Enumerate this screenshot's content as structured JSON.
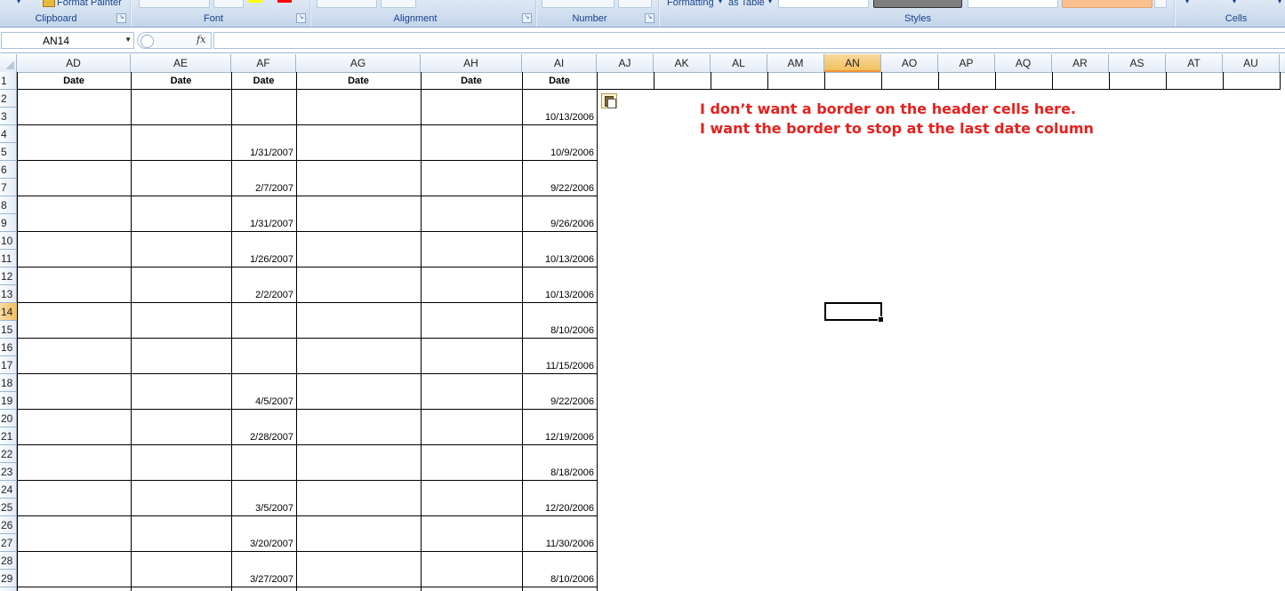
{
  "ribbon": {
    "clipboard": {
      "label": "Clipboard",
      "format_painter_label": "Format Painter"
    },
    "font": {
      "label": "Font"
    },
    "alignment": {
      "label": "Alignment"
    },
    "number": {
      "label": "Number"
    },
    "styles": {
      "label": "Styles",
      "formatting_label": "Formatting",
      "as_table_label": "as Table"
    },
    "cells": {
      "label": "Cells"
    }
  },
  "formula_bar": {
    "name_box": "AN14",
    "fx_label": "fx",
    "formula": ""
  },
  "columns": [
    "AD",
    "AE",
    "AF",
    "AG",
    "AH",
    "AI",
    "AJ",
    "AK",
    "AL",
    "AM",
    "AN",
    "AO",
    "AP",
    "AQ",
    "AR",
    "AS",
    "AT",
    "AU"
  ],
  "selected_column": "AN",
  "rows": [
    "1",
    "2",
    "3",
    "4",
    "5",
    "6",
    "7",
    "8",
    "9",
    "10",
    "11",
    "12",
    "13",
    "14",
    "15",
    "16",
    "17",
    "18",
    "19",
    "20",
    "21",
    "22",
    "23",
    "24",
    "25",
    "26",
    "27",
    "28",
    "29"
  ],
  "selected_row": "14",
  "header_row": {
    "AD": "Date",
    "AE": "Date",
    "AF": "Date",
    "AG": "Date",
    "AH": "Date",
    "AI": "Date"
  },
  "date_rows": [
    {
      "row": "3",
      "AF": "",
      "AI": "10/13/2006"
    },
    {
      "row": "5",
      "AF": "1/31/2007",
      "AI": "10/9/2006"
    },
    {
      "row": "7",
      "AF": "2/7/2007",
      "AI": "9/22/2006"
    },
    {
      "row": "9",
      "AF": "1/31/2007",
      "AI": "9/26/2006"
    },
    {
      "row": "11",
      "AF": "1/26/2007",
      "AI": "10/13/2006"
    },
    {
      "row": "13",
      "AF": "2/2/2007",
      "AI": "10/13/2006"
    },
    {
      "row": "15",
      "AF": "",
      "AI": "8/10/2006"
    },
    {
      "row": "17",
      "AF": "",
      "AI": "11/15/2006"
    },
    {
      "row": "19",
      "AF": "4/5/2007",
      "AI": "9/22/2006"
    },
    {
      "row": "21",
      "AF": "2/28/2007",
      "AI": "12/19/2006"
    },
    {
      "row": "23",
      "AF": "",
      "AI": "8/18/2006"
    },
    {
      "row": "25",
      "AF": "3/5/2007",
      "AI": "12/20/2006"
    },
    {
      "row": "27",
      "AF": "3/20/2007",
      "AI": "11/30/2006"
    },
    {
      "row": "29",
      "AF": "3/27/2007",
      "AI": "8/10/2006"
    }
  ],
  "annotation": {
    "line1": "I don’t want a border on the header  cells here.",
    "line2": "I want the border to stop at the last date column"
  },
  "icons": [
    "paste-options-icon",
    "fx-icon",
    "name-box-dropdown-icon",
    "select-all-icon"
  ],
  "colors": {
    "annotation": "#e8201d",
    "selection_header": "#f1c15f",
    "ribbon_label": "#15428b"
  }
}
